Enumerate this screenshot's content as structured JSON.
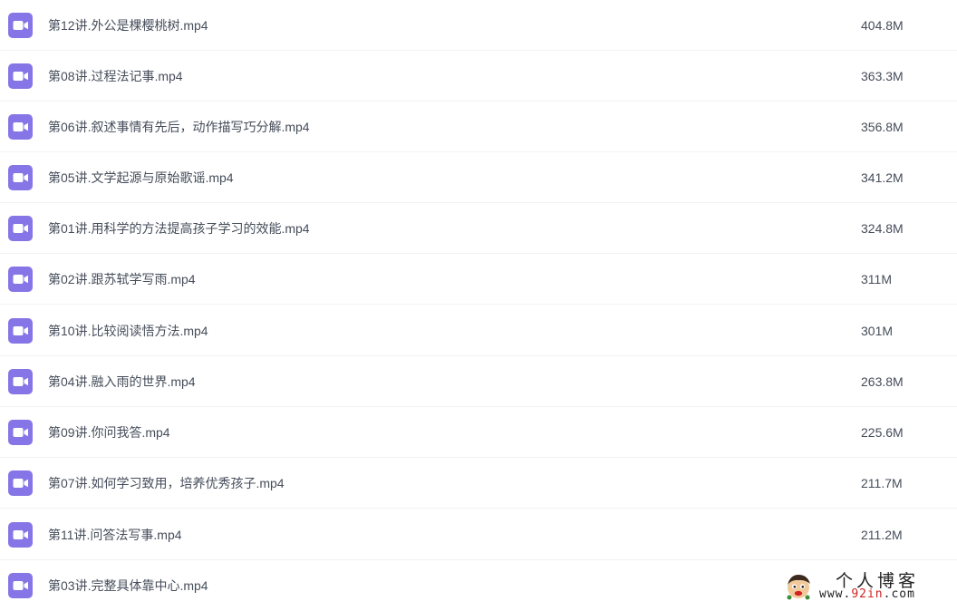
{
  "colors": {
    "icon_fill": "#8675e7",
    "text": "#454d5a",
    "row_divider": "#f1f2f4",
    "watermark_accent": "#d22222"
  },
  "files": [
    {
      "name": "第12讲.外公是棵樱桃树.mp4",
      "size": "404.8M",
      "icon": "video-file-icon"
    },
    {
      "name": "第08讲.过程法记事.mp4",
      "size": "363.3M",
      "icon": "video-file-icon"
    },
    {
      "name": "第06讲.叙述事情有先后，动作描写巧分解.mp4",
      "size": "356.8M",
      "icon": "video-file-icon"
    },
    {
      "name": "第05讲.文学起源与原始歌谣.mp4",
      "size": "341.2M",
      "icon": "video-file-icon"
    },
    {
      "name": "第01讲.用科学的方法提高孩子学习的效能.mp4",
      "size": "324.8M",
      "icon": "video-file-icon"
    },
    {
      "name": "第02讲.跟苏轼学写雨.mp4",
      "size": "311M",
      "icon": "video-file-icon"
    },
    {
      "name": "第10讲.比较阅读悟方法.mp4",
      "size": "301M",
      "icon": "video-file-icon"
    },
    {
      "name": "第04讲.融入雨的世界.mp4",
      "size": "263.8M",
      "icon": "video-file-icon"
    },
    {
      "name": "第09讲.你问我答.mp4",
      "size": "225.6M",
      "icon": "video-file-icon"
    },
    {
      "name": "第07讲.如何学习致用，培养优秀孩子.mp4",
      "size": "211.7M",
      "icon": "video-file-icon"
    },
    {
      "name": "第11讲.问答法写事.mp4",
      "size": "211.2M",
      "icon": "video-file-icon"
    },
    {
      "name": "第03讲.完整具体靠中心.mp4",
      "size": "",
      "icon": "video-file-icon"
    }
  ],
  "watermark": {
    "title": "个人博客",
    "url_prefix": "www.",
    "url_accent": "92in",
    "url_suffix": ".com",
    "logo": "cartoon-face-logo"
  }
}
